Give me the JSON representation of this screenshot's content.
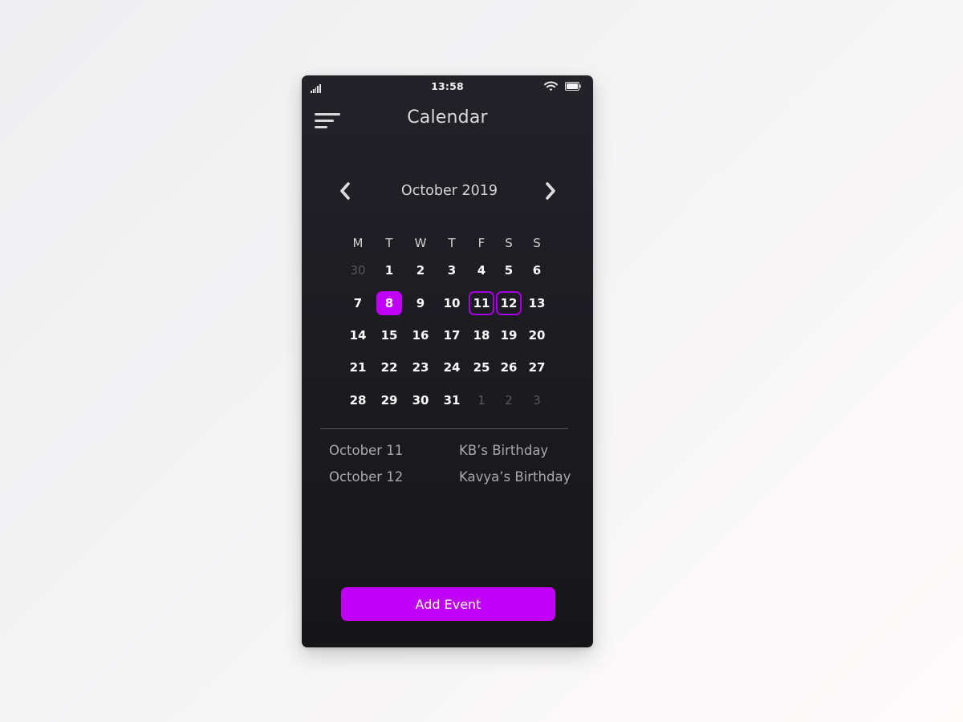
{
  "status_bar": {
    "time": "13:58"
  },
  "header": {
    "title": "Calendar",
    "menu_icon": "menu-icon"
  },
  "calendar": {
    "month_label": "October 2019",
    "prev_icon": "chevron-left-icon",
    "next_icon": "chevron-right-icon",
    "weekdays": [
      "M",
      "T",
      "W",
      "T",
      "F",
      "S",
      "S"
    ],
    "weeks": [
      [
        {
          "label": "30",
          "muted": true
        },
        {
          "label": "1"
        },
        {
          "label": "2"
        },
        {
          "label": "3"
        },
        {
          "label": "4"
        },
        {
          "label": "5"
        },
        {
          "label": "6"
        }
      ],
      [
        {
          "label": "7"
        },
        {
          "label": "8",
          "selected": true
        },
        {
          "label": "9"
        },
        {
          "label": "10"
        },
        {
          "label": "11",
          "event": true
        },
        {
          "label": "12",
          "event": true
        },
        {
          "label": "13"
        }
      ],
      [
        {
          "label": "14"
        },
        {
          "label": "15"
        },
        {
          "label": "16"
        },
        {
          "label": "17"
        },
        {
          "label": "18"
        },
        {
          "label": "19"
        },
        {
          "label": "20"
        }
      ],
      [
        {
          "label": "21"
        },
        {
          "label": "22"
        },
        {
          "label": "23"
        },
        {
          "label": "24"
        },
        {
          "label": "25"
        },
        {
          "label": "26"
        },
        {
          "label": "27"
        }
      ],
      [
        {
          "label": "28"
        },
        {
          "label": "29"
        },
        {
          "label": "30"
        },
        {
          "label": "31"
        },
        {
          "label": "1",
          "muted": true
        },
        {
          "label": "2",
          "muted": true
        },
        {
          "label": "3",
          "muted": true
        }
      ]
    ]
  },
  "events": [
    {
      "date": "October 11",
      "name": "KB’s Birthday"
    },
    {
      "date": "October 12",
      "name": "Kavya’s Birthday"
    }
  ],
  "actions": {
    "add_event_label": "Add Event"
  },
  "colors": {
    "accent": "#c000f6",
    "event_ring": "#a400e0",
    "background_top": "#232229",
    "background_bottom": "#161618"
  }
}
